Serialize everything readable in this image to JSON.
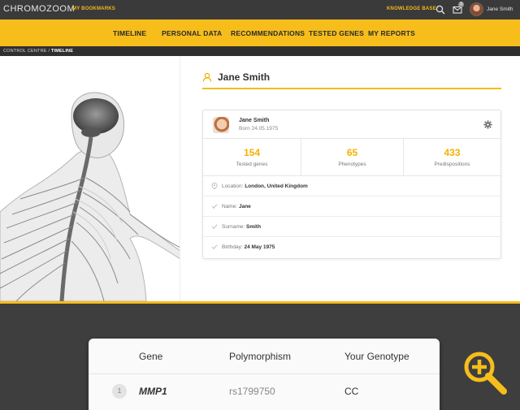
{
  "topbar": {
    "logo": "CHROMOZOOM",
    "bookmarks": "MY BOOKMARKS",
    "knowledge_base": "KNOWLEDGE BASE",
    "mail_badge": "3",
    "user_name": "Jane Smith"
  },
  "nav": {
    "items": [
      "TIMELINE",
      "PERSONAL DATA",
      "RECOMMENDATIONS",
      "TESTED GENES",
      "MY REPORTS"
    ]
  },
  "breadcrumb": {
    "root": "CONTROL CENTRE",
    "separator": " / ",
    "current": "TIMELINE"
  },
  "profile": {
    "title": "Jane Smith",
    "card_name": "Jane Smith",
    "born": "Born 24.05.1975",
    "stats": [
      {
        "value": "154",
        "label": "Tested genes"
      },
      {
        "value": "65",
        "label": "Phenotypes"
      },
      {
        "value": "433",
        "label": "Predispositions"
      }
    ],
    "fields": [
      {
        "label": "Location:",
        "value": "London, United Kingdom",
        "icon": "location-pin-icon"
      },
      {
        "label": "Name:",
        "value": "Jane",
        "icon": "check-icon"
      },
      {
        "label": "Surname:",
        "value": "Smith",
        "icon": "check-icon"
      },
      {
        "label": "Birthday:",
        "value": "24 May 1975",
        "icon": "check-icon"
      }
    ]
  },
  "gene_table": {
    "headers": [
      "Gene",
      "Polymorphism",
      "Your Genotype"
    ],
    "rows": [
      {
        "num": "1",
        "gene": "MMP1",
        "polymorphism": "rs1799750",
        "genotype": "CC"
      }
    ]
  },
  "colors": {
    "accent": "#f6bd1b",
    "topbar": "#3a3a3a",
    "stat_value": "#f3b100"
  }
}
